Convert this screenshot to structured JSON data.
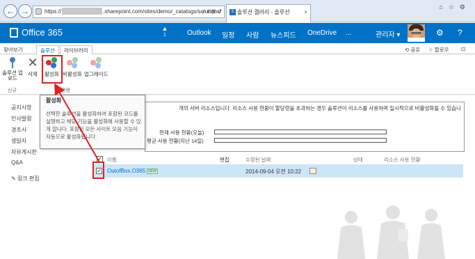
{
  "browser": {
    "url_prefix": "https://",
    "url_suffix": ".sharepoint.com/sites/demo/_catalogs/solutions/",
    "address_actions": "♁ ▾ ⊠ ↺",
    "tab_title": "솔루션 갤러리 - 솔루션",
    "tab_icon": "S",
    "tab_close": "×"
  },
  "suite_bar": {
    "brand": "Office 365",
    "notification_count": "1",
    "links": [
      "Outlook",
      "일정",
      "사람",
      "뉴스피드",
      "OneDrive",
      "..."
    ],
    "admin_label": "관리자 ▾",
    "icons": [
      "bell-icon",
      "gear-icon",
      "help-icon"
    ]
  },
  "ribbon_tabs": {
    "browse": "찾아보기",
    "solutions": "솔루션",
    "library": "라이브러리",
    "share": "공유",
    "follow": "팔로우"
  },
  "ribbon": {
    "upload_label": "솔루션 업로드",
    "new_group": "신규",
    "delete": "삭제",
    "activate": "활성화",
    "deactivate": "비활성화",
    "upgrade": "업그레이드",
    "commands_group": "명령"
  },
  "quick_launch": {
    "items": [
      "공지사항",
      "인사발령",
      "경조사",
      "생일자",
      "자유게시판",
      "Q&A"
    ],
    "edit_links": "링크 편집"
  },
  "status": {
    "message": "개의 서버 리소스입니다. 리소스 사용 현황이 할당량을 초과하는 경우 솔루션이 리소스를 사용하며 일시적으로 비활성화될 수 있습니",
    "current_usage": "현재 사용 현황(오늘)",
    "avg_usage": "평균 사용 현황(지난 14일)"
  },
  "list": {
    "headers": {
      "name": "이름",
      "edit": "편집",
      "modified": "수정된 날짜",
      "state": "상태",
      "resource_usage": "리소스 사용 현황"
    },
    "rows": [
      {
        "name": "OutofBox.O365",
        "badge": "NEW",
        "modified": "2014-09-04 오전 10:22"
      }
    ]
  },
  "tooltip": {
    "title": "활성화",
    "body": "선택한 솔루션을 활성화하여 포함된 코드를 실행하고 해당 기능을 활성화에 사용할 수 있게 합니다. 포함된 모든 사이트 모음 기능이 자동으로 활성화됩니다."
  },
  "colors": {
    "suite_blue": "#0072c6",
    "selected_row": "#cde6f7",
    "highlight_red": "#e02020"
  }
}
